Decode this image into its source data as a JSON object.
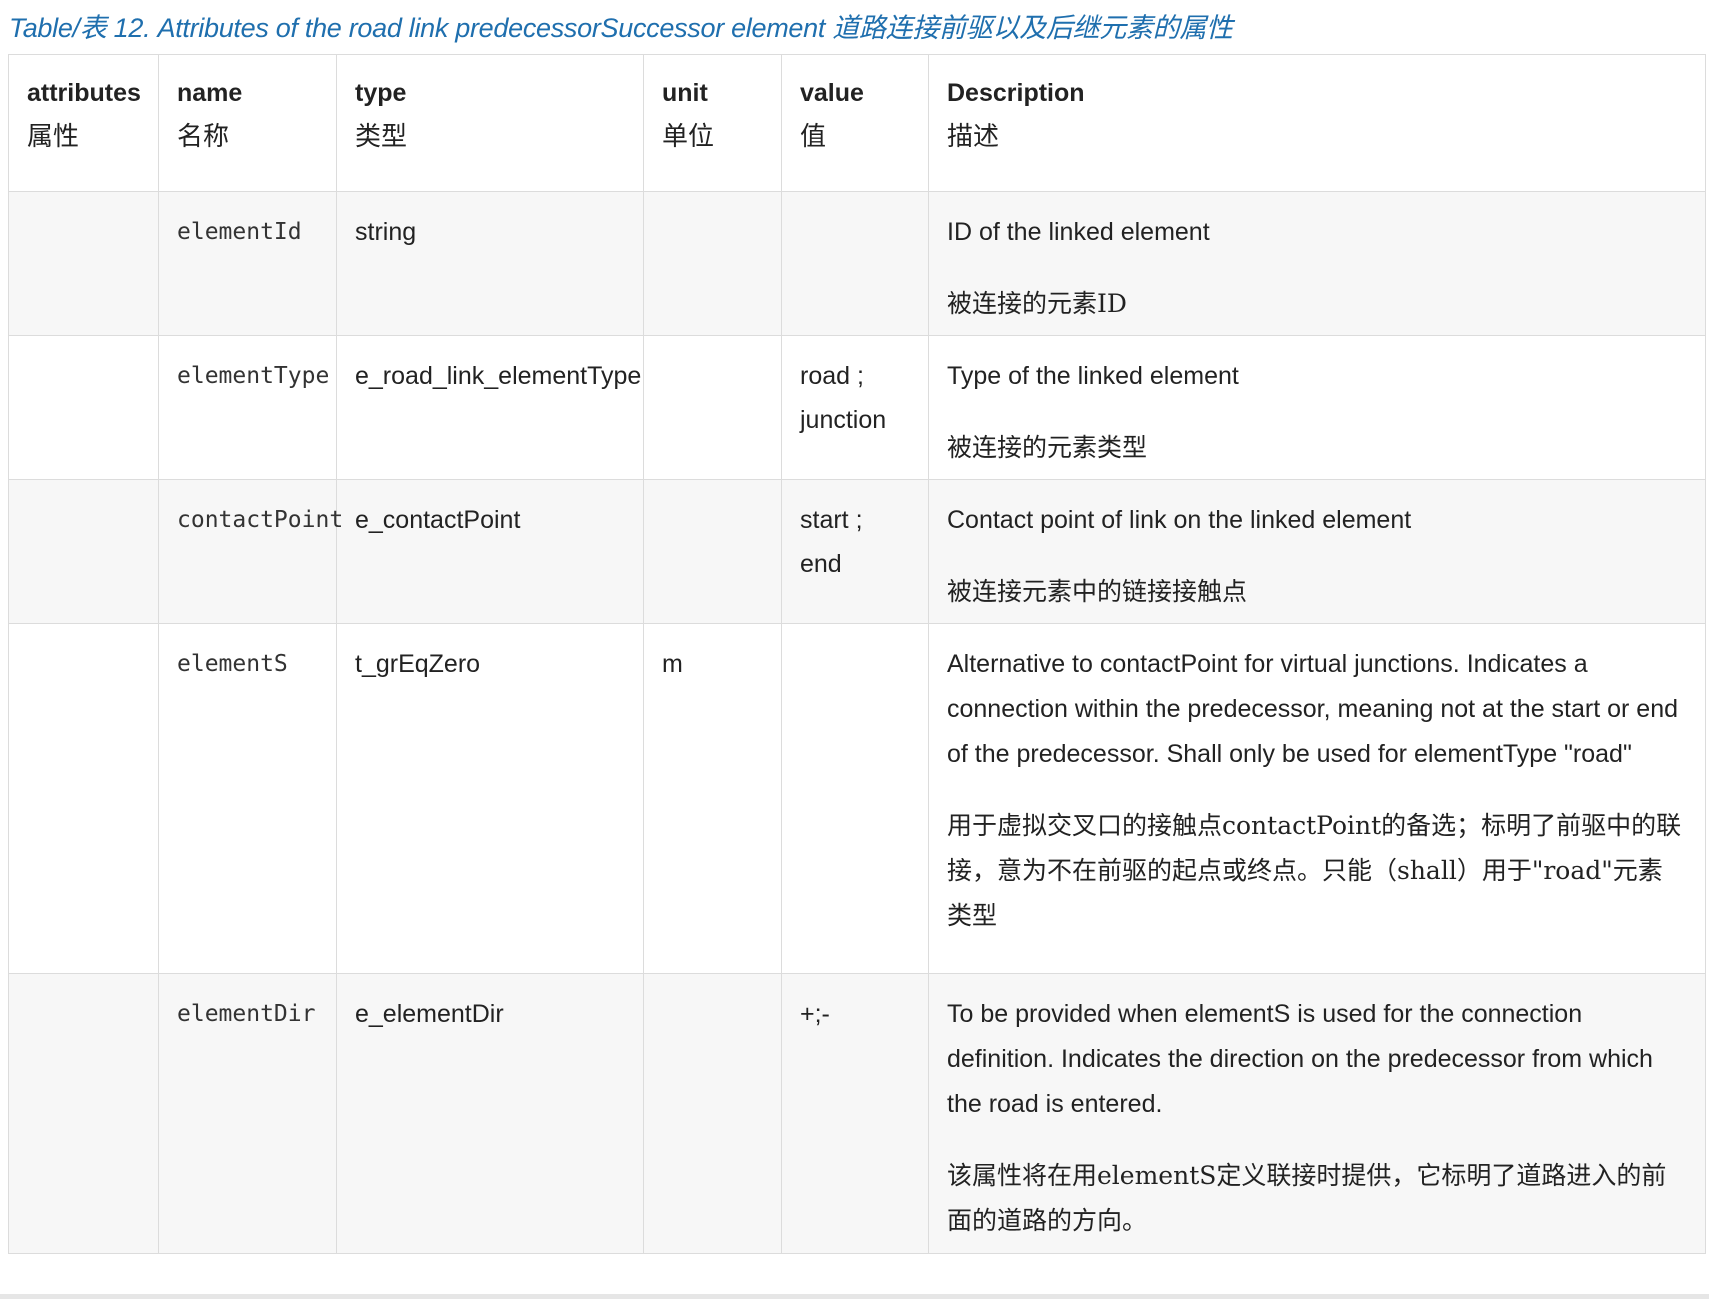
{
  "caption": "Table/表 12. Attributes of the road link predecessorSuccessor element 道路连接前驱以及后继元素的属性",
  "headers": [
    {
      "en": "attributes",
      "zh": "属性"
    },
    {
      "en": "name",
      "zh": "名称"
    },
    {
      "en": "type",
      "zh": "类型"
    },
    {
      "en": "unit",
      "zh": "单位"
    },
    {
      "en": "value",
      "zh": "值"
    },
    {
      "en": "Description",
      "zh": "描述"
    }
  ],
  "rows": [
    {
      "attributes": "",
      "name": "elementId",
      "type": "string",
      "unit": "",
      "value": "",
      "desc_en": "ID of the linked element",
      "desc_zh": "被连接的元素ID"
    },
    {
      "attributes": "",
      "name": "elementType",
      "type": "e_road_link_elementType",
      "unit": "",
      "value": "road ; junction",
      "desc_en": "Type of the linked element",
      "desc_zh": "被连接的元素类型"
    },
    {
      "attributes": "",
      "name": "contactPoint",
      "type": "e_contactPoint",
      "unit": "",
      "value": "start ; end",
      "desc_en": "Contact point of link on the linked element",
      "desc_zh": "被连接元素中的链接接触点"
    },
    {
      "attributes": "",
      "name": "elementS",
      "type": "t_grEqZero",
      "unit": "m",
      "value": "",
      "desc_en": "Alternative to contactPoint for virtual junctions. Indicates a connection within the predecessor, meaning not at the start or end of the predecessor. Shall only be used for elementType \"road\"",
      "desc_zh": "用于虚拟交叉口的接触点contactPoint的备选；标明了前驱中的联接，意为不在前驱的起点或终点。只能（shall）用于\"road\"元素类型"
    },
    {
      "attributes": "",
      "name": "elementDir",
      "type": "e_elementDir",
      "unit": "",
      "value": "+;-",
      "desc_en": "To be provided when elementS is used for the connection definition. Indicates the direction on the predecessor from which the road is entered.",
      "desc_zh": "该属性将在用elementS定义联接时提供，它标明了道路进入的前面的道路的方向。"
    }
  ]
}
